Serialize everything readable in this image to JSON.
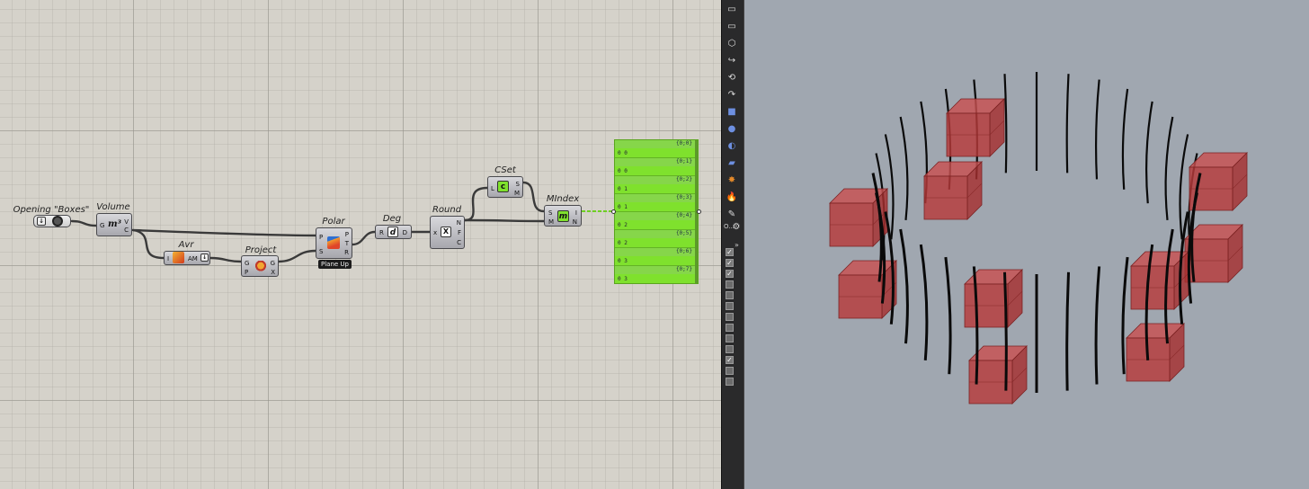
{
  "canvas": {
    "components": {
      "opening": {
        "title": "Opening \"Boxes\""
      },
      "volume": {
        "title": "Volume",
        "inputs": [
          "G"
        ],
        "outputs": [
          "V",
          "C"
        ],
        "icon": "m³"
      },
      "avr": {
        "title": "Avr",
        "inputs": [
          "I"
        ],
        "outputs": [
          "AM"
        ]
      },
      "project": {
        "title": "Project",
        "inputs": [
          "G",
          "P"
        ],
        "outputs": [
          "G",
          "X"
        ]
      },
      "polar": {
        "title": "Polar",
        "inputs": [
          "P",
          "S"
        ],
        "outputs": [
          "P",
          "T",
          "R"
        ],
        "tag": "Plane Up"
      },
      "deg": {
        "title": "Deg",
        "inputs": [
          "R"
        ],
        "outputs": [
          "D"
        ]
      },
      "round": {
        "title": "Round",
        "inputs": [
          "x"
        ],
        "outputs": [
          "N",
          "F",
          "C"
        ]
      },
      "cset": {
        "title": "CSet",
        "inputs": [
          "L"
        ],
        "outputs": [
          "S",
          "M"
        ]
      },
      "mindex": {
        "title": "MIndex",
        "inputs": [
          "S",
          "M"
        ],
        "outputs": [
          "I",
          "N"
        ]
      }
    },
    "panel": {
      "rows": [
        {
          "path": "{0;0}",
          "value": "0 0"
        },
        {
          "path": "{0;1}",
          "value": "0 0"
        },
        {
          "path": "{0;2}",
          "value": "0 1"
        },
        {
          "path": "{0;3}",
          "value": "0 1"
        },
        {
          "path": "{0;4}",
          "value": "0 2"
        },
        {
          "path": "{0;5}",
          "value": "0 2"
        },
        {
          "path": "{0;6}",
          "value": "0 3"
        },
        {
          "path": "{0;7}",
          "value": "0 3"
        }
      ],
      "color": "#7fe12d"
    }
  },
  "toolbar": {
    "menu_text": "O...",
    "more_glyph": "»",
    "checkboxes": [
      true,
      true,
      true,
      false,
      false,
      false,
      false,
      false,
      false,
      false,
      true,
      false,
      false
    ],
    "icons": [
      "rectangle-icon",
      "rectangle-icon",
      "polygon-icon",
      "curve-icon",
      "rebuild-icon",
      "sweep-icon",
      "box-icon",
      "sphere-icon",
      "pipe-icon",
      "surface-icon",
      "explode-icon",
      "fire-icon",
      "paint-icon",
      "gear-icon"
    ]
  },
  "colors": {
    "canvas": "#d5d2ca",
    "wire": "#3a3a3a",
    "component": "#b4b4b9",
    "viewport": "#a0a7b0",
    "box_red": "#b23535"
  }
}
